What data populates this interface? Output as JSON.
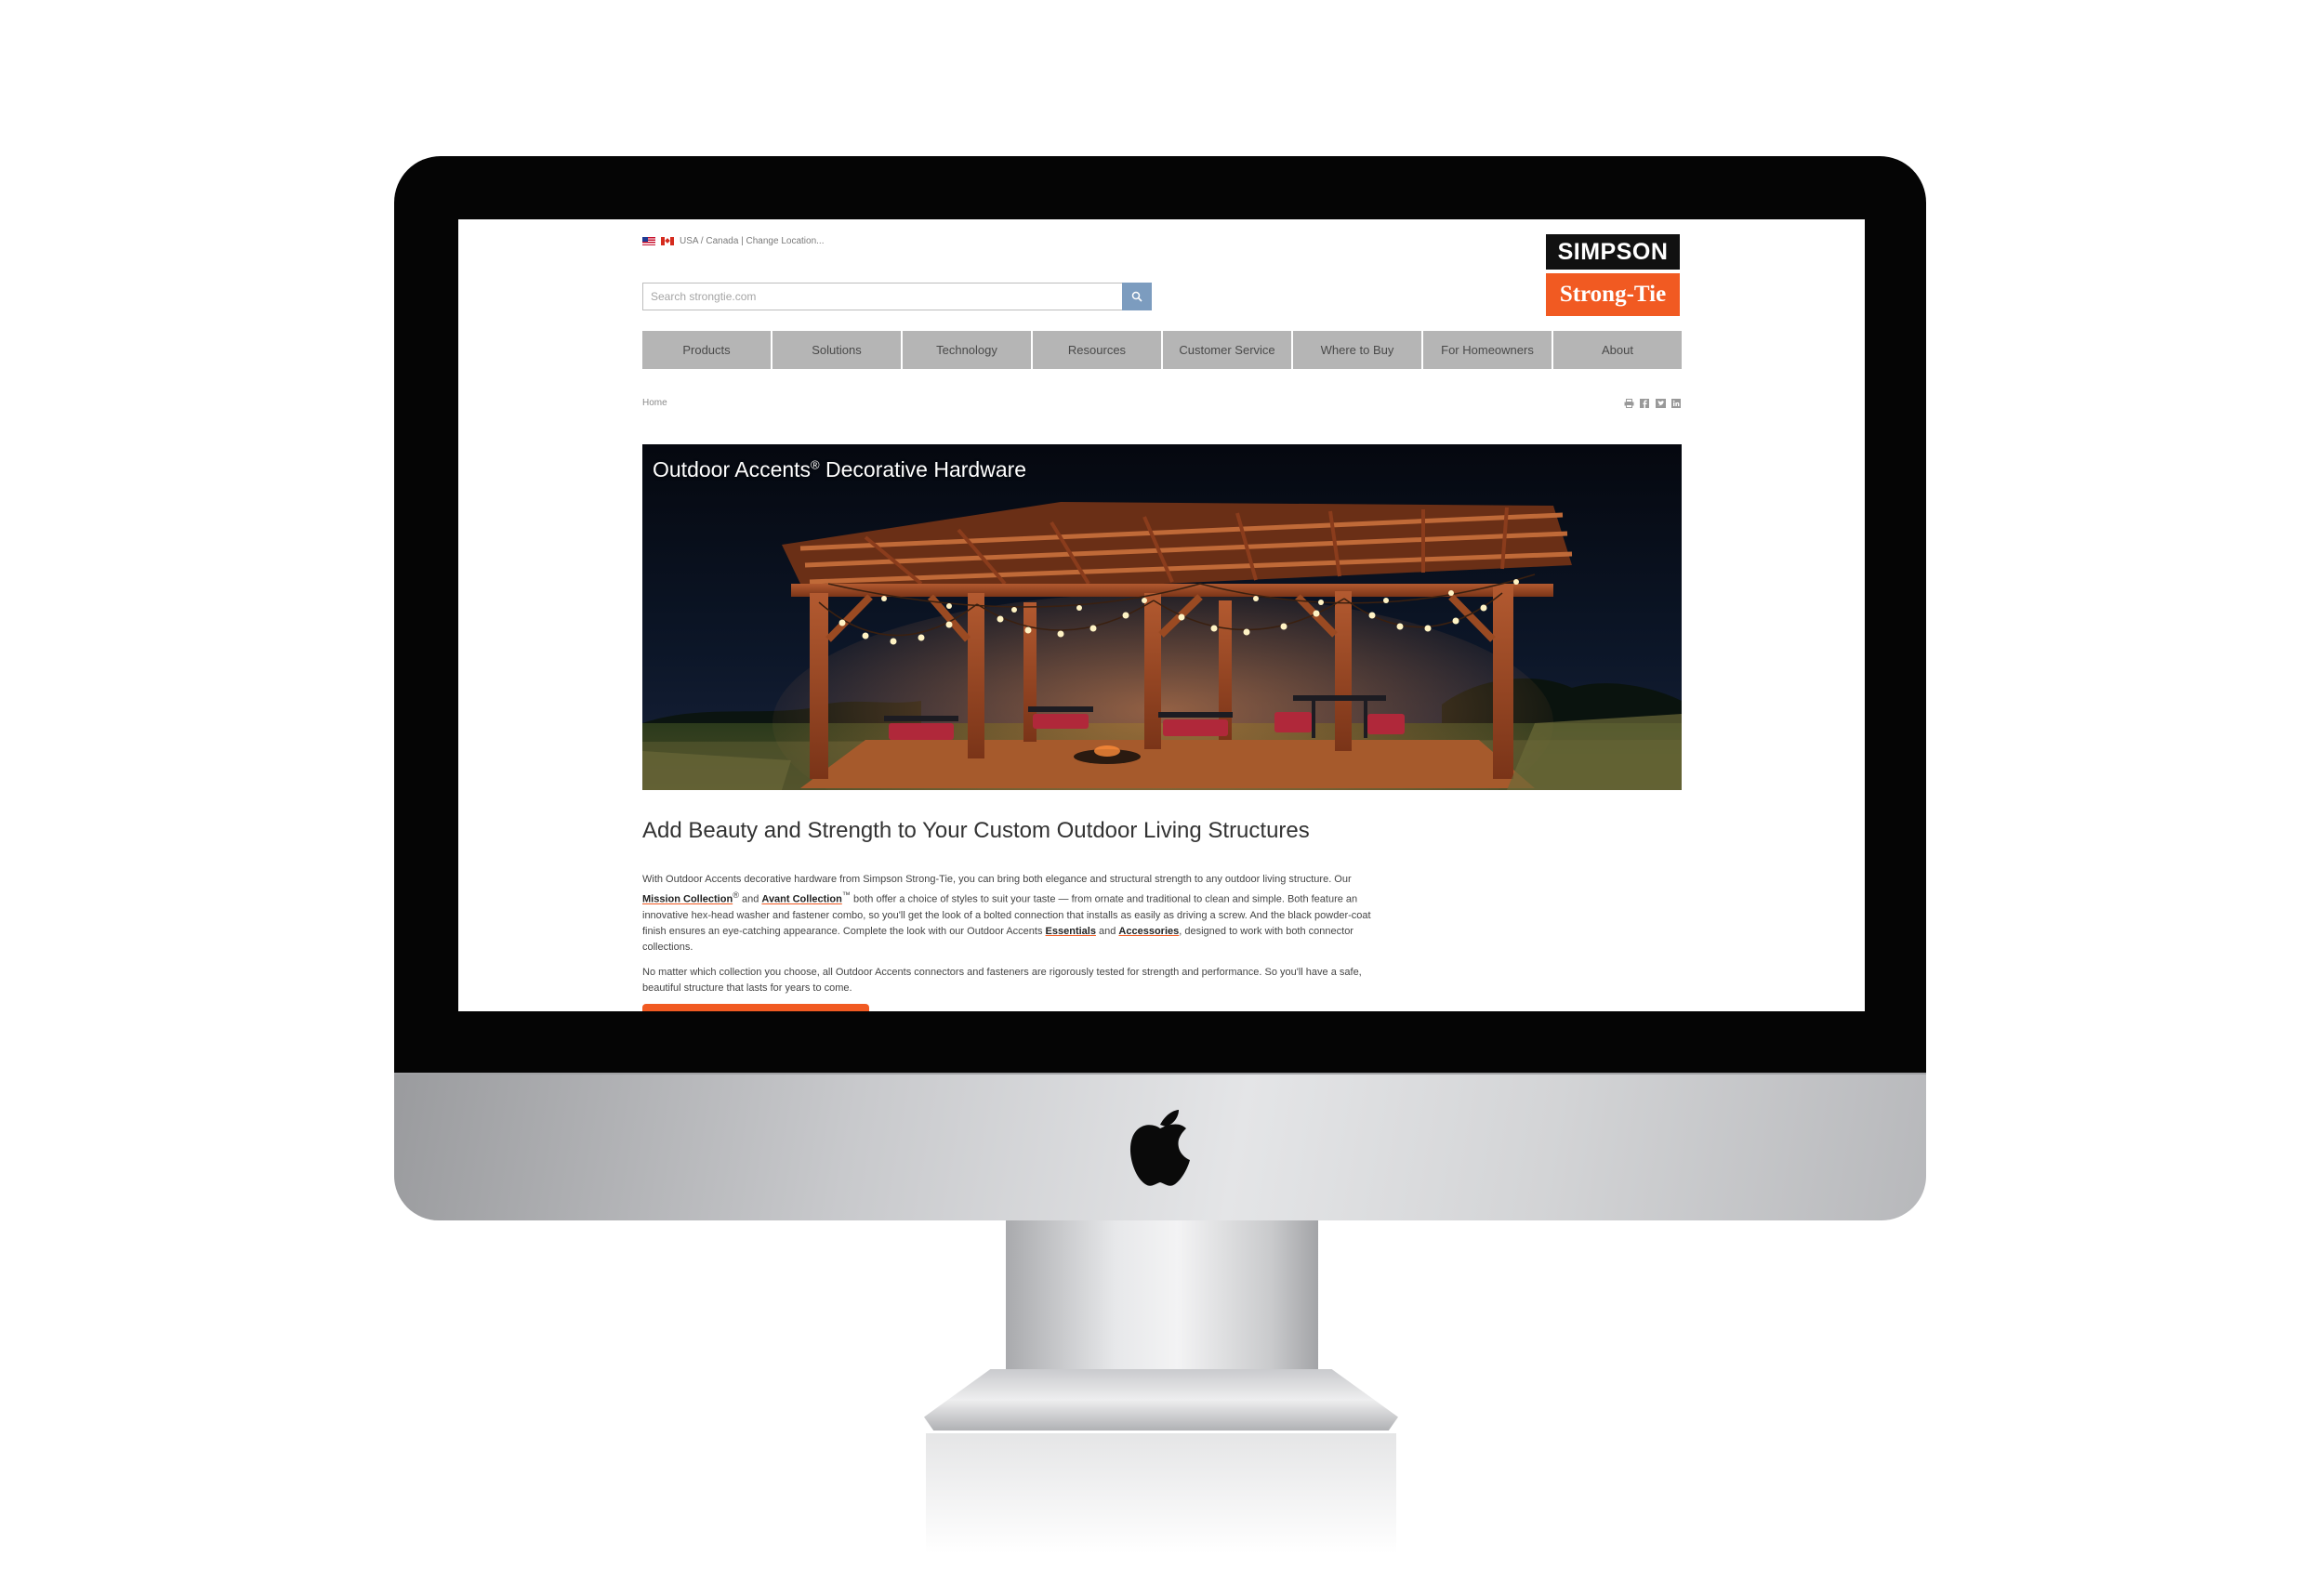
{
  "locale": {
    "text": "USA / Canada | Change Location..."
  },
  "search": {
    "placeholder": "Search strongtie.com",
    "icon": "search-icon"
  },
  "logo": {
    "top": "SIMPSON",
    "bottom": "Strong-Tie",
    "top_color": "#111111",
    "bottom_color": "#f15a22"
  },
  "nav": {
    "items": [
      {
        "label": "Products"
      },
      {
        "label": "Solutions"
      },
      {
        "label": "Technology"
      },
      {
        "label": "Resources"
      },
      {
        "label": "Customer Service"
      },
      {
        "label": "Where to Buy"
      },
      {
        "label": "For Homeowners"
      },
      {
        "label": "About"
      }
    ]
  },
  "breadcrumb": {
    "home": "Home"
  },
  "social": [
    "print-icon",
    "facebook-icon",
    "twitter-icon",
    "linkedin-icon"
  ],
  "hero": {
    "title": "Outdoor Accents",
    "title_mark": "®",
    "title_rest": " Decorative Hardware"
  },
  "main": {
    "headline": "Add Beauty and Strength to Your Custom Outdoor Living Structures",
    "p1_a": "With Outdoor Accents decorative hardware from Simpson Strong-Tie, you can bring both elegance and structural strength to any outdoor living structure. Our ",
    "link_mission": "Mission Collection",
    "mark_r": "®",
    "p1_b": " and ",
    "link_avant": "Avant Collection",
    "mark_tm": "™",
    "p1_c": " both offer a choice of styles to suit your taste — from ornate and traditional to clean and simple. Both feature an innovative hex-head washer and fastener combo, so you'll get the look of a bolted connection that installs as easily as driving a screw. And the black powder-coat finish ensures an eye-catching appearance. Complete the look with our Outdoor Accents ",
    "link_essentials": "Essentials",
    "p1_d": " and ",
    "link_accessories": "Accessories",
    "p1_e": ", designed to work with both connector collections.",
    "p2": "No matter which collection you choose, all Outdoor Accents connectors and fasteners are rigorously tested for strength and performance. So you'll have a safe, beautiful structure that lasts for years to come."
  },
  "colors": {
    "accent": "#f15a22",
    "nav_bg": "#b5b5b5",
    "search_button": "#7c9cbf"
  }
}
